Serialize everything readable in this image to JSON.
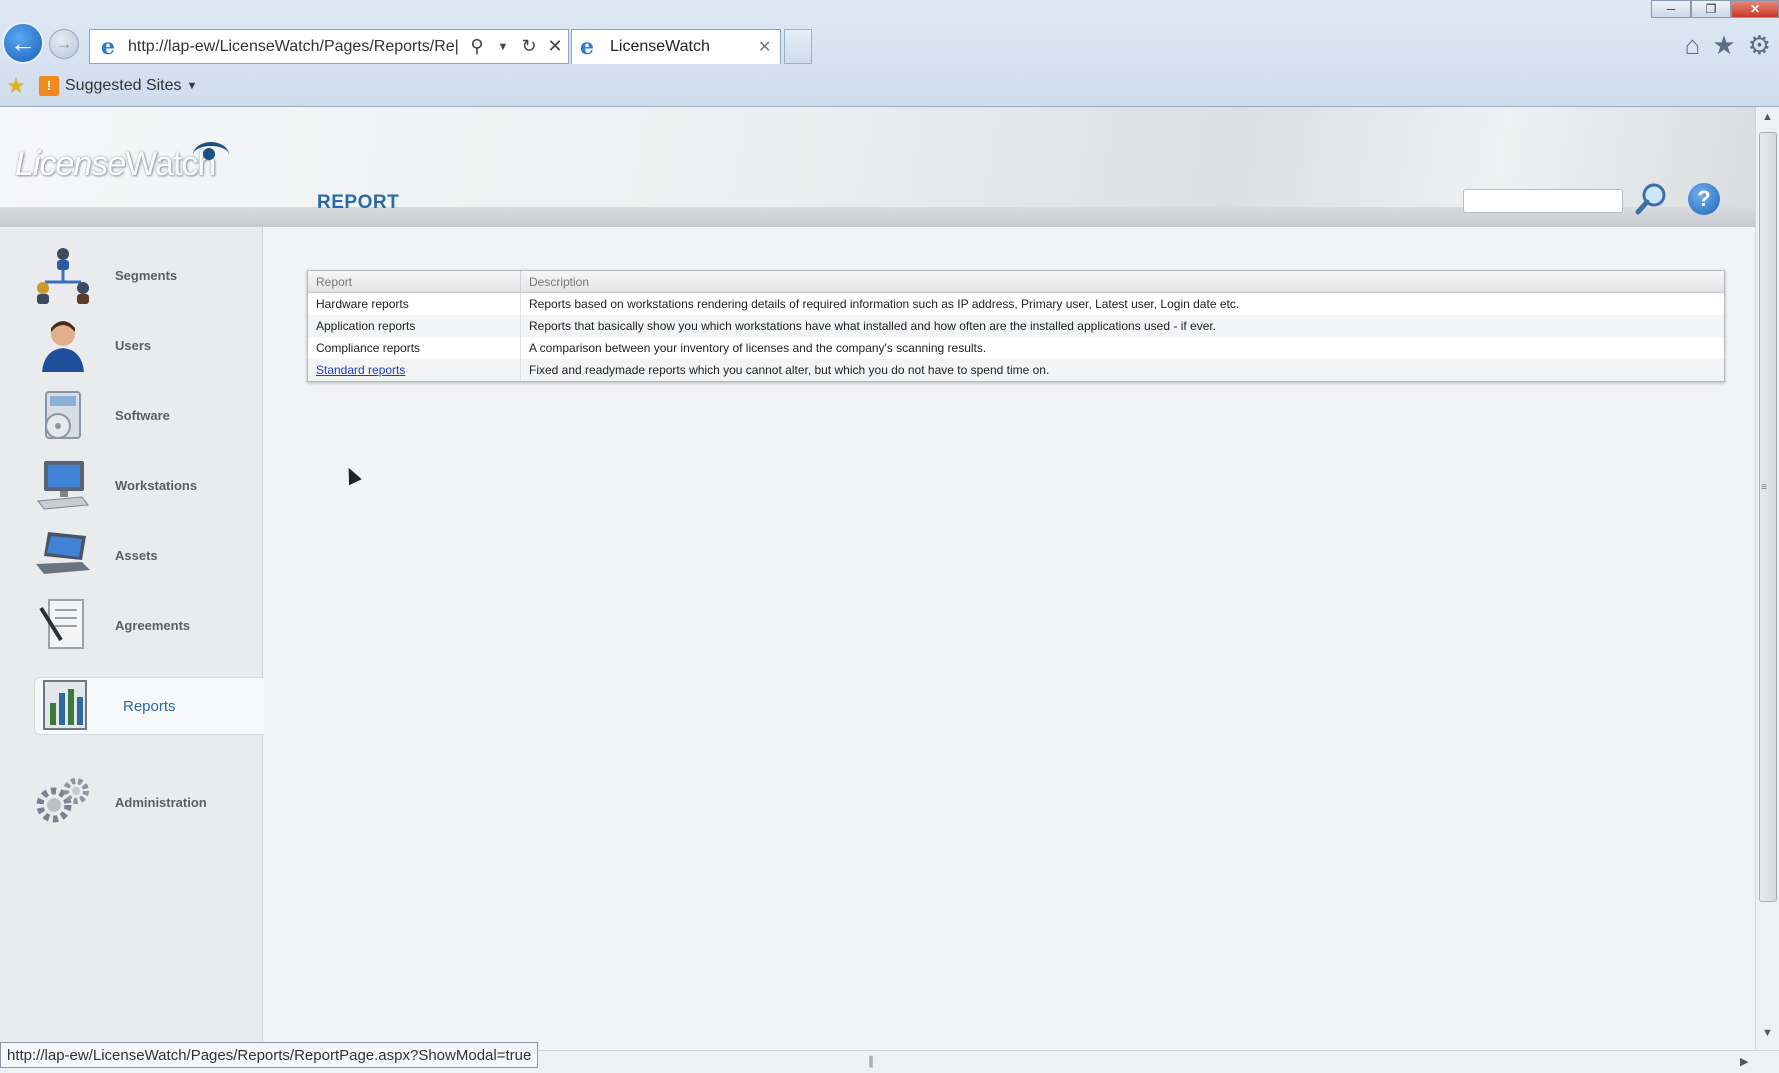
{
  "browser": {
    "address_url": "http://lap-ew/LicenseWatch/Pages/Reports/Re|",
    "tab_title": "LicenseWatch",
    "favorites_label": "Suggested Sites",
    "status_url": "http://lap-ew/LicenseWatch/Pages/Reports/ReportPage.aspx?ShowModal=true"
  },
  "app": {
    "logo_license": "License",
    "logo_watch": "Watch",
    "page_title": "REPORT",
    "search_placeholder": ""
  },
  "sidebar": {
    "items": [
      {
        "label": "Segments",
        "icon": "segments-icon"
      },
      {
        "label": "Users",
        "icon": "users-icon"
      },
      {
        "label": "Software",
        "icon": "software-icon"
      },
      {
        "label": "Workstations",
        "icon": "workstations-icon"
      },
      {
        "label": "Assets",
        "icon": "assets-icon"
      },
      {
        "label": "Agreements",
        "icon": "agreements-icon"
      },
      {
        "label": "Reports",
        "icon": "reports-icon",
        "active": true
      },
      {
        "label": "Administration",
        "icon": "administration-icon"
      }
    ]
  },
  "report_table": {
    "headers": {
      "report": "Report",
      "description": "Description"
    },
    "rows": [
      {
        "report": "Hardware reports",
        "description": "Reports based on workstations rendering details of required information such as IP address, Primary user, Latest user, Login date etc."
      },
      {
        "report": "Application reports",
        "description": "Reports that basically show you which workstations have what installed and how often are the installed applications used - if ever."
      },
      {
        "report": "Compliance reports",
        "description": "A comparison between your inventory of licenses and the company's scanning results."
      },
      {
        "report": "Standard reports",
        "description": "Fixed and readymade reports which you cannot alter, but which you do not have to spend time on."
      }
    ]
  },
  "colors": {
    "accent": "#2a6aa7",
    "link": "#1f3fbf"
  }
}
